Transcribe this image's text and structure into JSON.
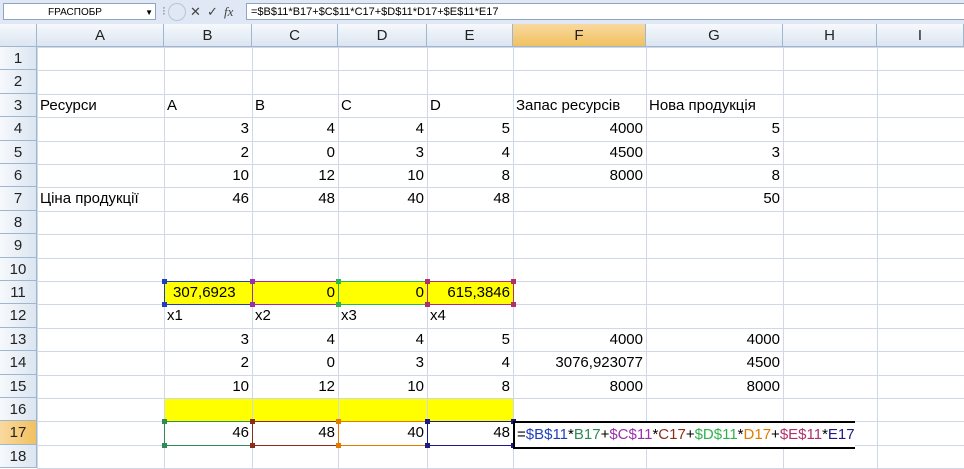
{
  "formula_bar": {
    "name_box": "FРАСПОБР",
    "buttons": {
      "cancel": "✕",
      "enter": "✓",
      "fx": "fx"
    },
    "formula": "=$B$11*B17+$C$11*C17+$D$11*D17+$E$11*E17"
  },
  "columns": [
    "A",
    "B",
    "C",
    "D",
    "E",
    "F",
    "G",
    "H",
    "I"
  ],
  "rows": [
    "1",
    "2",
    "3",
    "4",
    "5",
    "6",
    "7",
    "8",
    "9",
    "10",
    "11",
    "12",
    "13",
    "14",
    "15",
    "16",
    "17",
    "18"
  ],
  "cells": {
    "A3": "Ресурси",
    "B3": "A",
    "C3": "B",
    "D3": "C",
    "E3": "D",
    "F3": "Запас ресурсів",
    "G3": "Нова продукція",
    "B4": "3",
    "C4": "4",
    "D4": "4",
    "E4": "5",
    "F4": "4000",
    "G4": "5",
    "B5": "2",
    "C5": "0",
    "D5": "3",
    "E5": "4",
    "F5": "4500",
    "G5": "3",
    "B6": "10",
    "C6": "12",
    "D6": "10",
    "E6": "8",
    "F6": "8000",
    "G6": "8",
    "A7": "Ціна продукції",
    "B7": "46",
    "C7": "48",
    "D7": "40",
    "E7": "48",
    "G7": "50",
    "B11": "307,6923",
    "C11": "0",
    "D11": "0",
    "E11": "615,3846",
    "B12": "x1",
    "C12": "x2",
    "D12": "x3",
    "E12": "x4",
    "B13": "3",
    "C13": "4",
    "D13": "4",
    "E13": "5",
    "F13": "4000",
    "G13": "4000",
    "B14": "2",
    "C14": "0",
    "D14": "3",
    "E14": "4",
    "F14": "3076,923077",
    "G14": "4500",
    "B15": "10",
    "C15": "12",
    "D15": "10",
    "E15": "8",
    "F15": "8000",
    "G15": "8000",
    "B17": "46",
    "C17": "48",
    "D17": "40",
    "E17": "48"
  },
  "edit_formula": [
    {
      "text": "=",
      "color": "#000000"
    },
    {
      "text": "$B$11",
      "color": "#1f3fbf"
    },
    {
      "text": "*",
      "color": "#000000"
    },
    {
      "text": "B17",
      "color": "#2e8b57"
    },
    {
      "text": "+",
      "color": "#000000"
    },
    {
      "text": "$C$11",
      "color": "#9b2fae"
    },
    {
      "text": "*",
      "color": "#000000"
    },
    {
      "text": "C17",
      "color": "#8b2d1a"
    },
    {
      "text": "+",
      "color": "#000000"
    },
    {
      "text": "$D$11",
      "color": "#2fb34a"
    },
    {
      "text": "*",
      "color": "#000000"
    },
    {
      "text": "D17",
      "color": "#e07b00"
    },
    {
      "text": "+",
      "color": "#000000"
    },
    {
      "text": "$E$11",
      "color": "#b0306e"
    },
    {
      "text": "*",
      "color": "#000000"
    },
    {
      "text": "E17",
      "color": "#1a1a8b"
    }
  ],
  "colors": {
    "highlight": "#ffff00",
    "ref_B11": "#1f3fbf",
    "ref_C11": "#9b2fae",
    "ref_D11": "#2fb34a",
    "ref_E11": "#b0306e",
    "ref_B17": "#2e8b57",
    "ref_C17": "#8b2d1a",
    "ref_D17": "#e07b00",
    "ref_E17": "#1a1a8b"
  }
}
